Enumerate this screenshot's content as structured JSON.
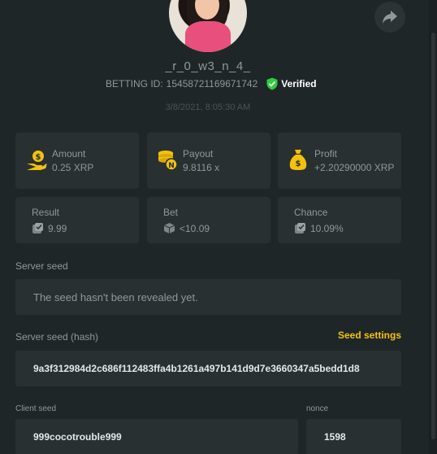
{
  "profile": {
    "username": "_r_0_w3_n_4_",
    "betting_id_label": "BETTING ID:",
    "betting_id": "15458721169671742",
    "verified_label": "Verified",
    "date": "3/8/2021, 8:05:30 AM"
  },
  "stats": {
    "amount": {
      "label": "Amount",
      "value": "0.25 XRP"
    },
    "payout": {
      "label": "Payout",
      "value": "9.8116 x"
    },
    "profit": {
      "label": "Profit",
      "value": "+2.20290000 XRP"
    },
    "result": {
      "label": "Result",
      "value": "9.99"
    },
    "bet": {
      "label": "Bet",
      "value": "<10.09"
    },
    "chance": {
      "label": "Chance",
      "value": "10.09%"
    }
  },
  "server_seed": {
    "label": "Server seed",
    "value": "The seed hasn't been revealed yet."
  },
  "server_seed_hash": {
    "label": "Server seed (hash)",
    "settings_link": "Seed settings",
    "value": "9a3f312984d2c686f112483ffa4b1261a497b141d9d7e3660347a5bedd1d8"
  },
  "client_seed": {
    "label": "Client seed",
    "value": "999cocotrouble999"
  },
  "nonce": {
    "label": "nonce",
    "value": "1598"
  },
  "colors": {
    "accent": "#f4c20d",
    "verified": "#2ecc40",
    "background": "#1f2628",
    "card": "#283032"
  },
  "icons": [
    "share-icon",
    "verified-check-icon",
    "money-hand-icon",
    "coins-stack-icon",
    "money-bag-icon",
    "dice-result-icon",
    "dice-bet-icon",
    "dice-chance-icon"
  ]
}
